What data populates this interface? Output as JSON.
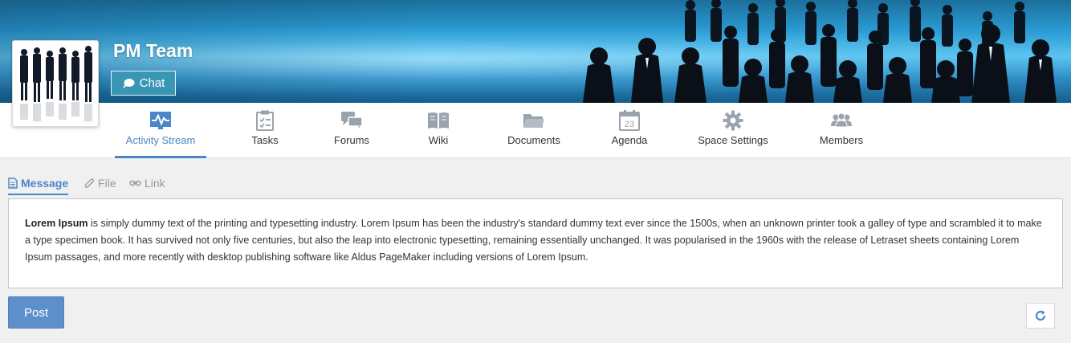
{
  "space": {
    "title": "PM Team",
    "chat_label": "Chat"
  },
  "nav": {
    "items": [
      {
        "label": "Activity Stream",
        "icon": "activity-icon",
        "active": true
      },
      {
        "label": "Tasks",
        "icon": "tasks-icon",
        "active": false
      },
      {
        "label": "Forums",
        "icon": "forums-icon",
        "active": false
      },
      {
        "label": "Wiki",
        "icon": "wiki-icon",
        "active": false
      },
      {
        "label": "Documents",
        "icon": "folder-icon",
        "active": false
      },
      {
        "label": "Agenda",
        "icon": "calendar-icon",
        "active": false,
        "icon_text": "23"
      },
      {
        "label": "Space Settings",
        "icon": "gear-icon",
        "active": false
      },
      {
        "label": "Members",
        "icon": "members-icon",
        "active": false
      }
    ]
  },
  "composer": {
    "tabs": {
      "message": "Message",
      "file": "File",
      "link": "Link"
    },
    "text_bold": "Lorem Ipsum",
    "text_rest": " is simply dummy text of the printing and typesetting industry. Lorem Ipsum has been the industry's standard dummy text ever since the 1500s, when an unknown printer took a galley of type and scrambled it to make a type specimen book. It has survived not only five centuries, but also the leap into electronic typesetting, remaining essentially unchanged. It was popularised in the 1960s with the release of Letraset sheets containing Lorem Ipsum passages, and more recently with desktop publishing software like Aldus PageMaker including versions of Lorem Ipsum.",
    "post_label": "Post",
    "refresh_icon": "refresh-icon"
  },
  "colors": {
    "accent": "#4a87c6",
    "post_button": "#5d8fcc",
    "chat_button": "#3a96b5",
    "icon_gray": "#9aa3ad"
  }
}
